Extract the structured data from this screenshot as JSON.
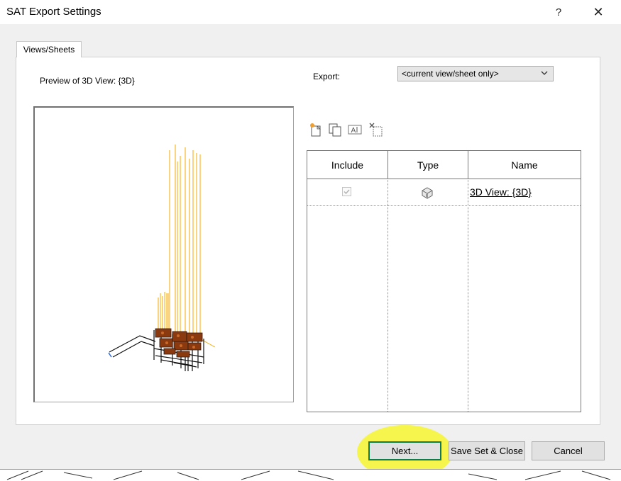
{
  "window": {
    "title": "SAT Export Settings",
    "help_glyph": "?",
    "close_glyph": "✕"
  },
  "tabs": [
    {
      "label": "Views/Sheets"
    }
  ],
  "preview": {
    "label": "Preview of 3D View: {3D}"
  },
  "export": {
    "label": "Export:",
    "selected_value": "<current view/sheet only>"
  },
  "toolbar_icons": [
    "new-set-icon",
    "duplicate-set-icon",
    "rename-set-icon",
    "delete-set-icon"
  ],
  "table": {
    "columns": [
      "Include",
      "Type",
      "Name"
    ],
    "rows": [
      {
        "include": true,
        "type_icon": "3d-view-icon",
        "name": "3D View: {3D}"
      }
    ]
  },
  "buttons": {
    "next": "Next...",
    "save_close": "Save Set & Close",
    "cancel": "Cancel"
  },
  "colors": {
    "accent_border": "#0f7c50",
    "highlight": "#f5f528",
    "model_lines": "#f5a800"
  }
}
